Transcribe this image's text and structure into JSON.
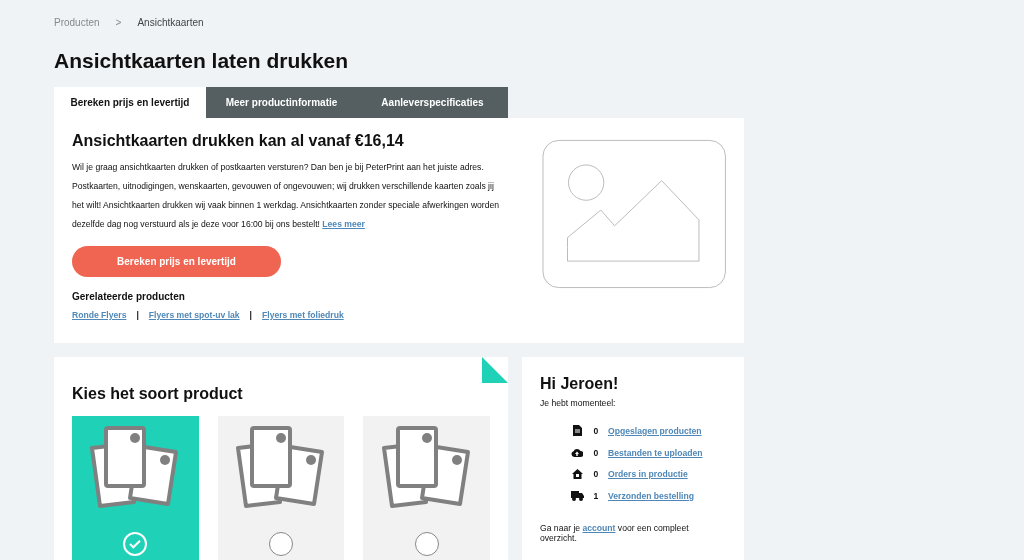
{
  "breadcrumb": {
    "items": [
      "Producten",
      "Ansichtkaarten"
    ],
    "separator": ">"
  },
  "title": "Ansichtkaarten laten drukken",
  "tabs": [
    {
      "label": "Bereken prijs en levertijd",
      "selected": true
    },
    {
      "label": "Meer productinformatie",
      "selected": false
    },
    {
      "label": "Aanleverspecificaties",
      "selected": false
    }
  ],
  "intro": {
    "heading": "Ansichtkaarten drukken kan al vanaf €16,14",
    "text": "Wil je graag ansichtkaarten drukken of postkaarten versturen? Dan ben je bij PeterPrint aan het juiste adres. Postkaarten, uitnodigingen, wenskaarten, gevouwen of ongevouwen; wij drukken verschillende kaarten zoals jij het wilt! Ansichtkaarten drukken wij vaak binnen 1 werkdag. Ansichtkaarten zonder speciale afwerkingen worden dezelfde dag nog verstuurd als je deze voor 16:00 bij ons bestelt!",
    "link": "Lees meer",
    "button": "Bereken prijs en levertijd",
    "related_heading": "Gerelateerde producten",
    "related_links": [
      "Ronde Flyers",
      "Flyers met spot-uv lak",
      "Flyers met foliedruk"
    ],
    "related_separators": [
      "|",
      "|"
    ]
  },
  "product_types": {
    "heading": "Kies het soort product",
    "options": [
      {
        "selected": true
      },
      {
        "selected": false
      },
      {
        "selected": false
      }
    ]
  },
  "account": {
    "greeting": "Hi Jeroen!",
    "subtitle": "Je hebt momenteel:",
    "items": [
      {
        "kind": "file",
        "count": "0",
        "label": "Opgeslagen producten"
      },
      {
        "kind": "upload",
        "count": "0",
        "label": "Bestanden te uploaden"
      },
      {
        "kind": "house",
        "count": "0",
        "label": "Orders in productie"
      },
      {
        "kind": "truck",
        "count": "1",
        "label": "Verzonden bestelling"
      }
    ],
    "footer_before": "Ga naar je",
    "footer_link": "account",
    "footer_after": "voor een compleet overzicht."
  }
}
